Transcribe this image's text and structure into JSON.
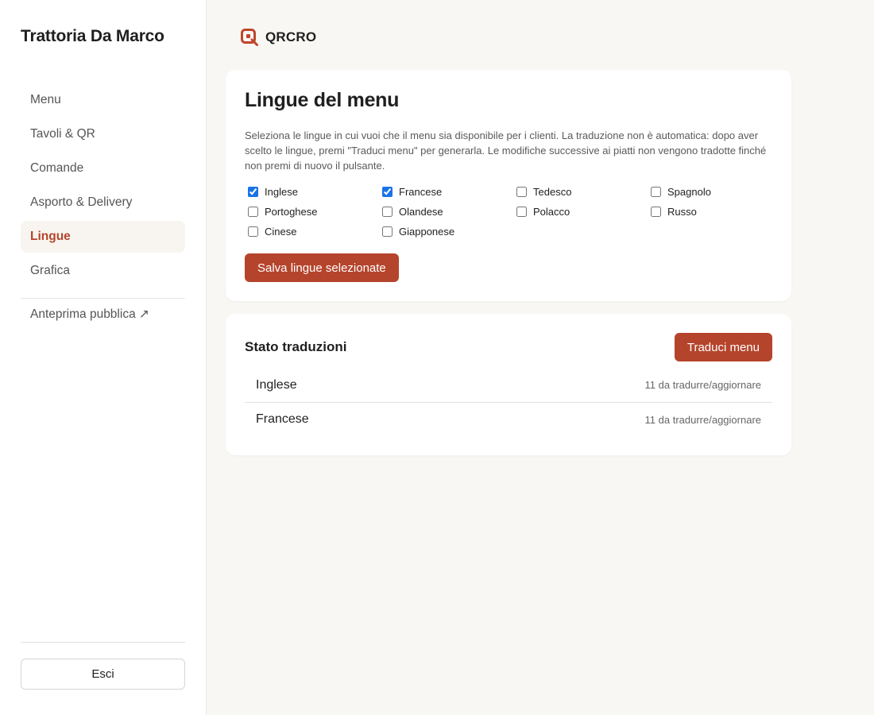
{
  "sidebar": {
    "restaurant_name": "Trattoria Da Marco",
    "nav": [
      {
        "label": "Menu",
        "active": false
      },
      {
        "label": "Tavoli & QR",
        "active": false
      },
      {
        "label": "Comande",
        "active": false
      },
      {
        "label": "Asporto & Delivery",
        "active": false
      },
      {
        "label": "Lingue",
        "active": true
      },
      {
        "label": "Grafica",
        "active": false
      }
    ],
    "preview_link": "Anteprima pubblica ↗",
    "logout_label": "Esci"
  },
  "brand": {
    "name": "QRCRO",
    "logo_icon": "qr-logo-icon",
    "color": "#c0452b"
  },
  "languages_card": {
    "title": "Lingue del menu",
    "description": "Seleziona le lingue in cui vuoi che il menu sia disponibile per i clienti. La traduzione non è automatica: dopo aver scelto le lingue, premi \"Traduci menu\" per generarla. Le modifiche successive ai piatti non vengono tradotte finché non premi di nuovo il pulsante.",
    "languages": [
      {
        "label": "Inglese",
        "checked": true
      },
      {
        "label": "Francese",
        "checked": true
      },
      {
        "label": "Tedesco",
        "checked": false
      },
      {
        "label": "Spagnolo",
        "checked": false
      },
      {
        "label": "Portoghese",
        "checked": false
      },
      {
        "label": "Olandese",
        "checked": false
      },
      {
        "label": "Polacco",
        "checked": false
      },
      {
        "label": "Russo",
        "checked": false
      },
      {
        "label": "Cinese",
        "checked": false
      },
      {
        "label": "Giapponese",
        "checked": false
      }
    ],
    "save_label": "Salva lingue selezionate"
  },
  "status_card": {
    "title": "Stato traduzioni",
    "translate_label": "Traduci menu",
    "rows": [
      {
        "language": "Inglese",
        "status": "11 da tradurre/aggiornare"
      },
      {
        "language": "Francese",
        "status": "11 da tradurre/aggiornare"
      }
    ]
  },
  "colors": {
    "accent": "#b5442c",
    "background": "#f9f7f4",
    "active_nav_bg": "#f8f5f0"
  }
}
